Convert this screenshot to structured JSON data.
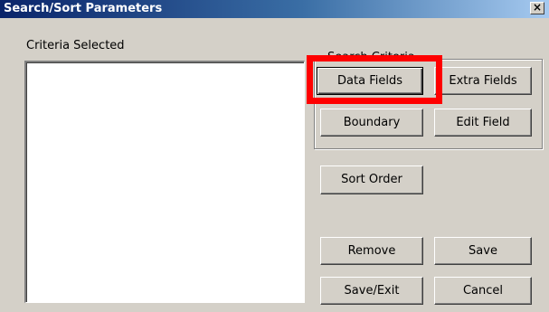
{
  "window": {
    "title": "Search/Sort Parameters",
    "close_label": "×"
  },
  "criteria": {
    "label": "Criteria Selected",
    "items": []
  },
  "search_criteria": {
    "label": "Search Criteria",
    "buttons": {
      "data_fields": "Data Fields",
      "extra_fields": "Extra Fields",
      "boundary": "Boundary",
      "edit_field": "Edit Field"
    }
  },
  "actions": {
    "sort_order": "Sort Order",
    "remove": "Remove",
    "save": "Save",
    "save_exit": "Save/Exit",
    "cancel": "Cancel"
  },
  "annotation": {
    "highlight_color": "#ff0000",
    "highlighted": "data_fields"
  }
}
